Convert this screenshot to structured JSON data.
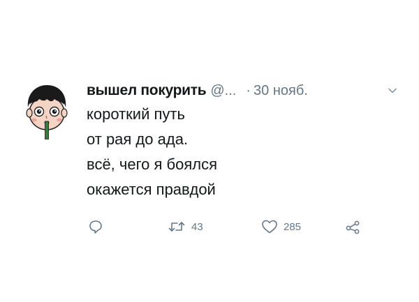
{
  "tweet": {
    "display_name": "вышел покурить",
    "handle": "@...",
    "separator": "·",
    "date": "30 нояб.",
    "lines": [
      "короткий путь",
      "от рая до ада.",
      "всё, чего я боялся",
      "окажется правдой"
    ],
    "avatar_icon": "cartoon-face-cigarette-avatar",
    "actions": {
      "reply_icon": "reply-icon",
      "retweet_icon": "retweet-icon",
      "retweet_count": "43",
      "like_icon": "heart-icon",
      "like_count": "285",
      "share_icon": "share-icon"
    },
    "colors": {
      "text": "#14171a",
      "secondary": "#657786"
    }
  }
}
